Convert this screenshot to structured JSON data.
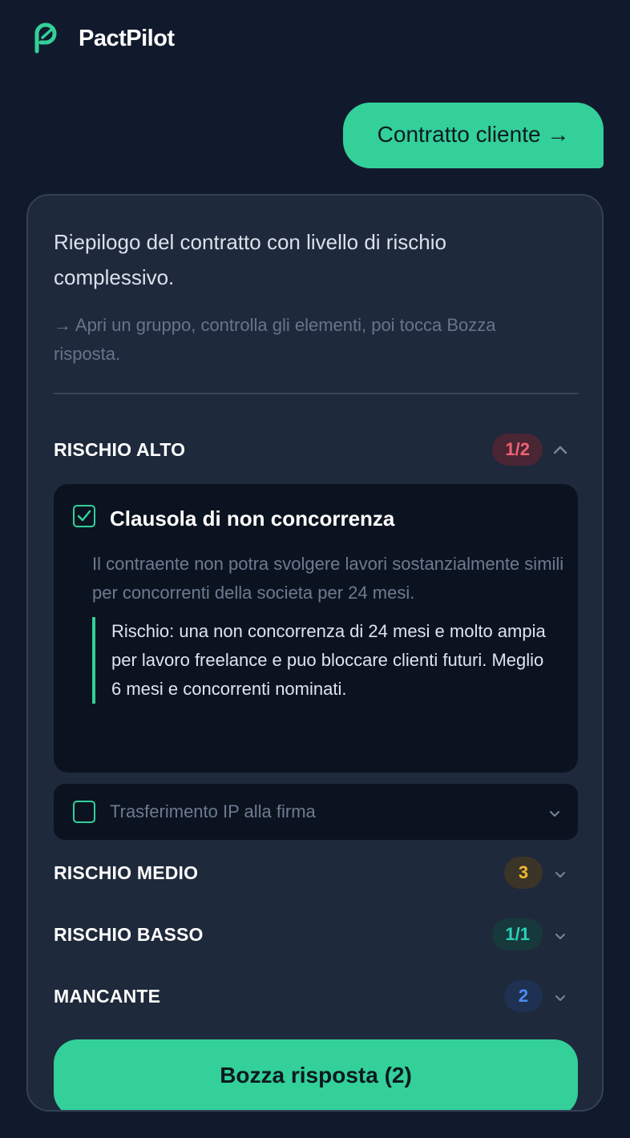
{
  "app": {
    "name": "PactPilot",
    "logo_icon": "pilot-leaf-icon"
  },
  "user_message": {
    "text": "Contratto cliente →"
  },
  "response": {
    "summary": "Riepilogo del contratto con livello di rischio complessivo.",
    "hint": "→ Apri un gruppo, controlla gli elementi, poi tocca Bozza risposta."
  },
  "groups": [
    {
      "title": "RISCHIO ALTO",
      "badge": "1/2",
      "badge_bg": "#4a2533",
      "badge_fg": "#f06275",
      "expanded": true
    },
    {
      "title": "RISCHIO MEDIO",
      "badge": "3",
      "badge_bg": "#3b3528",
      "badge_fg": "#f5b82e",
      "expanded": false
    },
    {
      "title": "RISCHIO BASSO",
      "badge": "1/1",
      "badge_bg": "#17393c",
      "badge_fg": "#2bd1b8",
      "expanded": false
    },
    {
      "title": "MANCANTE",
      "badge": "2",
      "badge_bg": "#1f3152",
      "badge_fg": "#4a8df0",
      "expanded": false
    }
  ],
  "high_risk_items": [
    {
      "title": "Clausola di non concorrenza",
      "checked": true,
      "description": "Il contraente non potra svolgere lavori sostanzialmente simili per concorrenti della societa per 24 mesi.",
      "risk": "Rischio: una non concorrenza di 24 mesi e molto ampia per lavoro freelance e puo bloccare clienti futuri. Meglio 6 mesi e concorrenti nominati."
    },
    {
      "title": "Trasferimento IP alla firma",
      "checked": false
    }
  ],
  "cta": {
    "label": "Bozza risposta (2)"
  },
  "colors": {
    "accent": "#33d09a",
    "background": "#111a2c",
    "card": "#1e293b",
    "item": "#0c1320"
  }
}
